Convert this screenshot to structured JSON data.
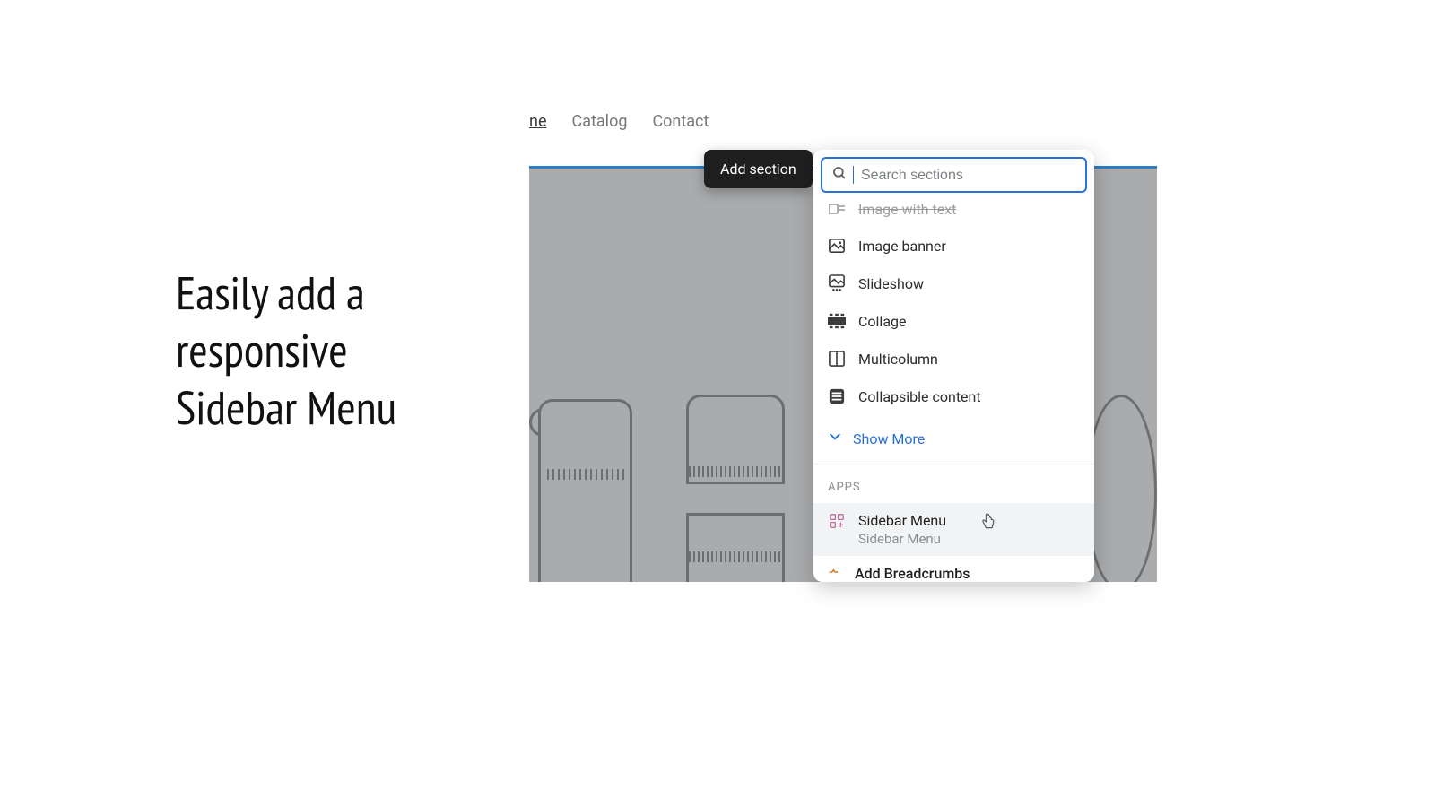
{
  "headline": "Easily add a\nresponsive\nSidebar Menu",
  "nav": {
    "items": [
      "ne",
      "Catalog",
      "Contact"
    ],
    "current_index": 0
  },
  "tooltip": {
    "label": "Add section"
  },
  "search": {
    "placeholder": "Search sections"
  },
  "cutoff_item": {
    "label": "Image with text"
  },
  "sections": [
    {
      "icon": "image-icon",
      "label": "Image banner"
    },
    {
      "icon": "slideshow-icon",
      "label": "Slideshow"
    },
    {
      "icon": "collage-icon",
      "label": "Collage"
    },
    {
      "icon": "multicolumn-icon",
      "label": "Multicolumn"
    },
    {
      "icon": "collapsible-icon",
      "label": "Collapsible content"
    }
  ],
  "show_more": "Show More",
  "apps_label": "APPS",
  "apps": [
    {
      "title": "Sidebar Menu",
      "subtitle": "Sidebar Menu",
      "hovered": true
    },
    {
      "title": "Add Breadcrumbs",
      "subtitle": "",
      "cutoff": true
    }
  ]
}
